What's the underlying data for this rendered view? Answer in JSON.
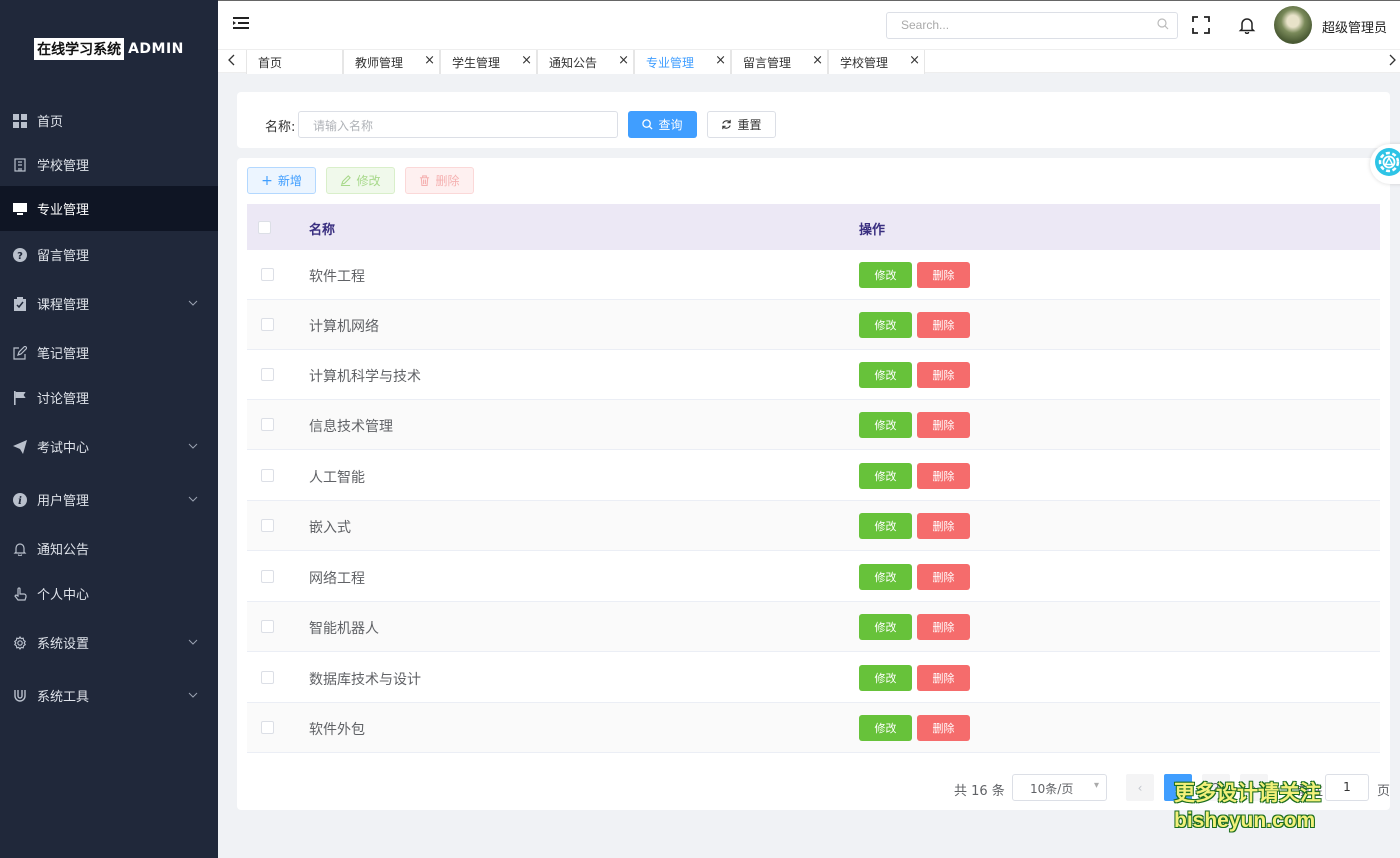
{
  "sidebar": {
    "logo_text": "在线学习系统",
    "logo_suffix": "ADMIN",
    "items": [
      {
        "label": "首页",
        "icon": "grid-icon"
      },
      {
        "label": "学校管理",
        "icon": "building-icon"
      },
      {
        "label": "专业管理",
        "icon": "monitor-icon",
        "active": true
      },
      {
        "label": "留言管理",
        "icon": "question-icon"
      },
      {
        "label": "课程管理",
        "icon": "clipboard-icon",
        "expandable": true
      },
      {
        "label": "笔记管理",
        "icon": "edit-icon"
      },
      {
        "label": "讨论管理",
        "icon": "flag-icon"
      },
      {
        "label": "考试中心",
        "icon": "send-icon",
        "expandable": true
      },
      {
        "label": "用户管理",
        "icon": "info-icon",
        "expandable": true
      },
      {
        "label": "通知公告",
        "icon": "bell-icon"
      },
      {
        "label": "个人中心",
        "icon": "hand-icon"
      },
      {
        "label": "系统设置",
        "icon": "gear-icon",
        "expandable": true
      },
      {
        "label": "系统工具",
        "icon": "magnet-icon",
        "expandable": true
      }
    ]
  },
  "header": {
    "search_placeholder": "Search...",
    "username": "超级管理员"
  },
  "tabs": [
    {
      "label": "首页",
      "closable": false
    },
    {
      "label": "教师管理",
      "closable": true
    },
    {
      "label": "学生管理",
      "closable": true
    },
    {
      "label": "通知公告",
      "closable": true
    },
    {
      "label": "专业管理",
      "closable": true,
      "active": true
    },
    {
      "label": "留言管理",
      "closable": true
    },
    {
      "label": "学校管理",
      "closable": true
    }
  ],
  "filter": {
    "name_label": "名称:",
    "name_placeholder": "请输入名称",
    "query_label": "查询",
    "reset_label": "重置"
  },
  "toolbar": {
    "add_label": "新增",
    "edit_label": "修改",
    "delete_label": "删除"
  },
  "table": {
    "columns": [
      "名称",
      "操作"
    ],
    "edit_label": "修改",
    "delete_label": "删除",
    "rows": [
      "软件工程",
      "计算机网络",
      "计算机科学与技术",
      "信息技术管理",
      "人工智能",
      "嵌入式",
      "网络工程",
      "智能机器人",
      "数据库技术与设计",
      "软件外包"
    ]
  },
  "pagination": {
    "total_text": "共 16 条",
    "page_size": "10条/页",
    "pages": [
      "1",
      "2"
    ],
    "current_page": "1",
    "goto_label": "前往",
    "goto_value": "1",
    "unit": "页"
  },
  "watermark": {
    "line1": "更多设计请关注",
    "line2": "bisheyun.com"
  },
  "colors": {
    "primary": "#409eff",
    "success": "#67c23a",
    "danger": "#f56c6c",
    "sidebar_bg": "#20283a"
  }
}
